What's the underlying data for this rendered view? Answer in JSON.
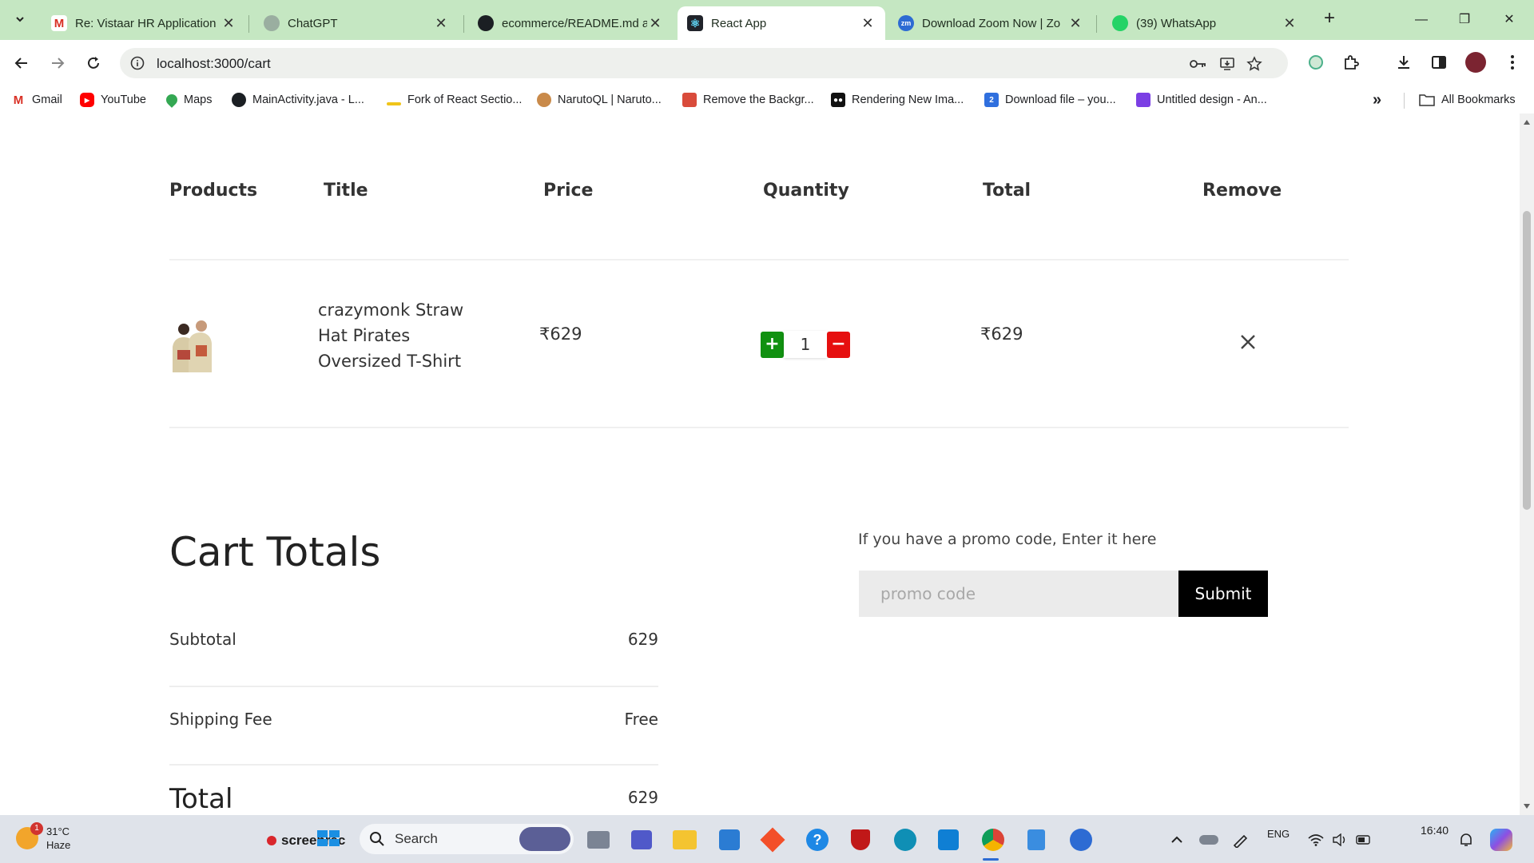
{
  "browser": {
    "tabs": [
      {
        "title": "Re: Vistaar HR Application",
        "favicon": "gmail-icon",
        "active": false
      },
      {
        "title": "ChatGPT",
        "favicon": "chatgpt-icon",
        "active": false
      },
      {
        "title": "ecommerce/README.md a",
        "favicon": "github-icon",
        "active": false
      },
      {
        "title": "React App",
        "favicon": "react-icon",
        "active": true
      },
      {
        "title": "Download Zoom Now | Zo",
        "favicon": "zoom-icon",
        "active": false
      },
      {
        "title": "(39) WhatsApp",
        "favicon": "whatsapp-icon",
        "active": false
      }
    ],
    "url": "localhost:3000/cart",
    "bookmarks": [
      {
        "label": "Gmail"
      },
      {
        "label": "YouTube"
      },
      {
        "label": "Maps"
      },
      {
        "label": "MainActivity.java - L..."
      },
      {
        "label": "Fork of React Sectio..."
      },
      {
        "label": "NarutoQL | Naruto..."
      },
      {
        "label": "Remove the Backgr..."
      },
      {
        "label": "Rendering New Ima..."
      },
      {
        "label": "Download file – you..."
      },
      {
        "label": "Untitled design - An..."
      }
    ],
    "more_bookmarks": "»",
    "all_bookmarks": "All Bookmarks"
  },
  "cart": {
    "headers": [
      "Products",
      "Title",
      "Price",
      "Quantity",
      "Total",
      "Remove"
    ],
    "items": [
      {
        "title": "crazymonk Straw Hat Pirates Oversized T-Shirt",
        "price": "₹629",
        "quantity": "1",
        "total": "₹629",
        "plus_label": "+",
        "minus_label": "−"
      }
    ]
  },
  "totals": {
    "heading": "Cart Totals",
    "subtotal_label": "Subtotal",
    "subtotal_value": "629",
    "shipping_label": "Shipping Fee",
    "shipping_value": "Free",
    "total_label": "Total",
    "total_value": "629"
  },
  "promo": {
    "label": "If you have a promo code, Enter it here",
    "placeholder": "promo code",
    "submit_label": "Submit"
  },
  "taskbar": {
    "temperature": "31°C",
    "weather": "Haze",
    "weather_badge": "1",
    "screenrec_label": "screenrec",
    "search_label": "Search",
    "language": "ENG",
    "time": "16:40"
  },
  "colors": {
    "tabstrip": "#c5e7c2",
    "qty_plus": "#119111",
    "qty_minus": "#e60f0f",
    "submit_bg": "#000000"
  }
}
